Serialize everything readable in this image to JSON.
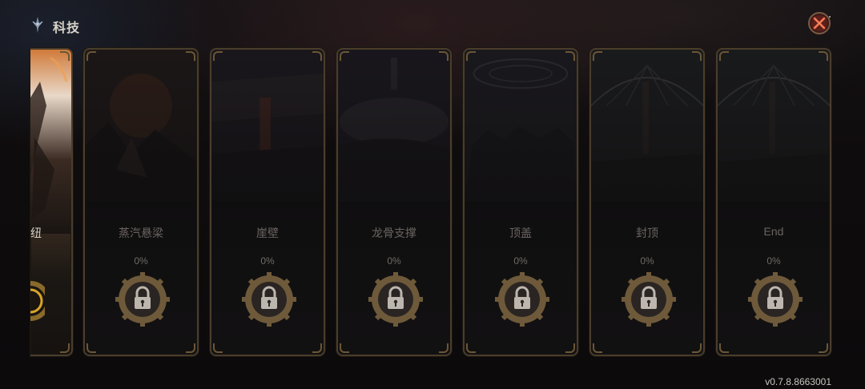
{
  "header": {
    "title": "科技",
    "icon": "compass-emblem-icon",
    "close_icon": "close-x-icon"
  },
  "cards": [
    {
      "name": "纽",
      "state": "unlocked-partial"
    },
    {
      "name": "蒸汽悬梁",
      "progress": "0%",
      "state": "locked"
    },
    {
      "name": "崖壁",
      "progress": "0%",
      "state": "locked"
    },
    {
      "name": "龙骨支撑",
      "progress": "0%",
      "state": "locked"
    },
    {
      "name": "顶盖",
      "progress": "0%",
      "state": "locked"
    },
    {
      "name": "封顶",
      "progress": "0%",
      "state": "locked"
    },
    {
      "name": "End",
      "progress": "0%",
      "state": "locked"
    }
  ],
  "lock_icon": "gear-padlock-icon",
  "version": "v0.7.8.8663001",
  "colors": {
    "frame": "#4a3d2b",
    "gear": "#6e5a3a",
    "close_accent": "#c0392b",
    "text_dim": "#6a6460"
  }
}
